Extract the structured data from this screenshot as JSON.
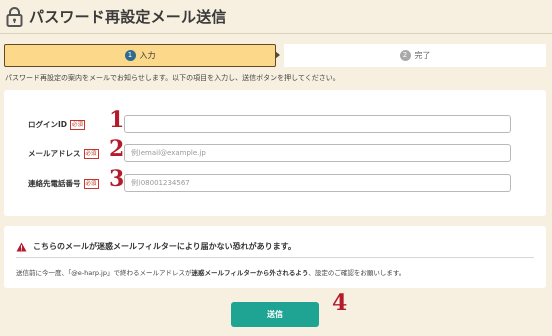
{
  "header": {
    "title": "パスワード再設定メール送信",
    "icon": "lock-icon"
  },
  "steps": [
    {
      "number": "1",
      "label": "入力",
      "active": true
    },
    {
      "number": "2",
      "label": "完了",
      "active": false
    }
  ],
  "description": "パスワード再設定の案内をメールでお知らせします。以下の項目を入力し、送信ボタンを押してください。",
  "form": {
    "fields": [
      {
        "label": "ログインID",
        "required": "必須",
        "annotation": "1",
        "value": "",
        "placeholder": ""
      },
      {
        "label": "メールアドレス",
        "required": "必須",
        "annotation": "2",
        "value": "",
        "placeholder": "例)email@example.jp"
      },
      {
        "label": "連絡先電話番号",
        "required": "必須",
        "annotation": "3",
        "value": "",
        "placeholder": "例)08001234567"
      }
    ]
  },
  "warning": {
    "title": "こちらのメールが迷惑メールフィルターにより届かない恐れがあります。",
    "text_before": "送信前に今一度、「@e-harp.jp」で終わるメールアドレスが",
    "text_bold": "迷惑メールフィルターから外されるよう",
    "text_after": "、設定のご確認をお願いします。",
    "icon": "warning-icon"
  },
  "submit": {
    "label": "送信",
    "annotation": "4"
  },
  "colors": {
    "background": "#f7f0e0",
    "active_step": "#fbd88a",
    "button": "#1fa393",
    "annotation": "#b31b2d",
    "required": "#c0392b"
  }
}
